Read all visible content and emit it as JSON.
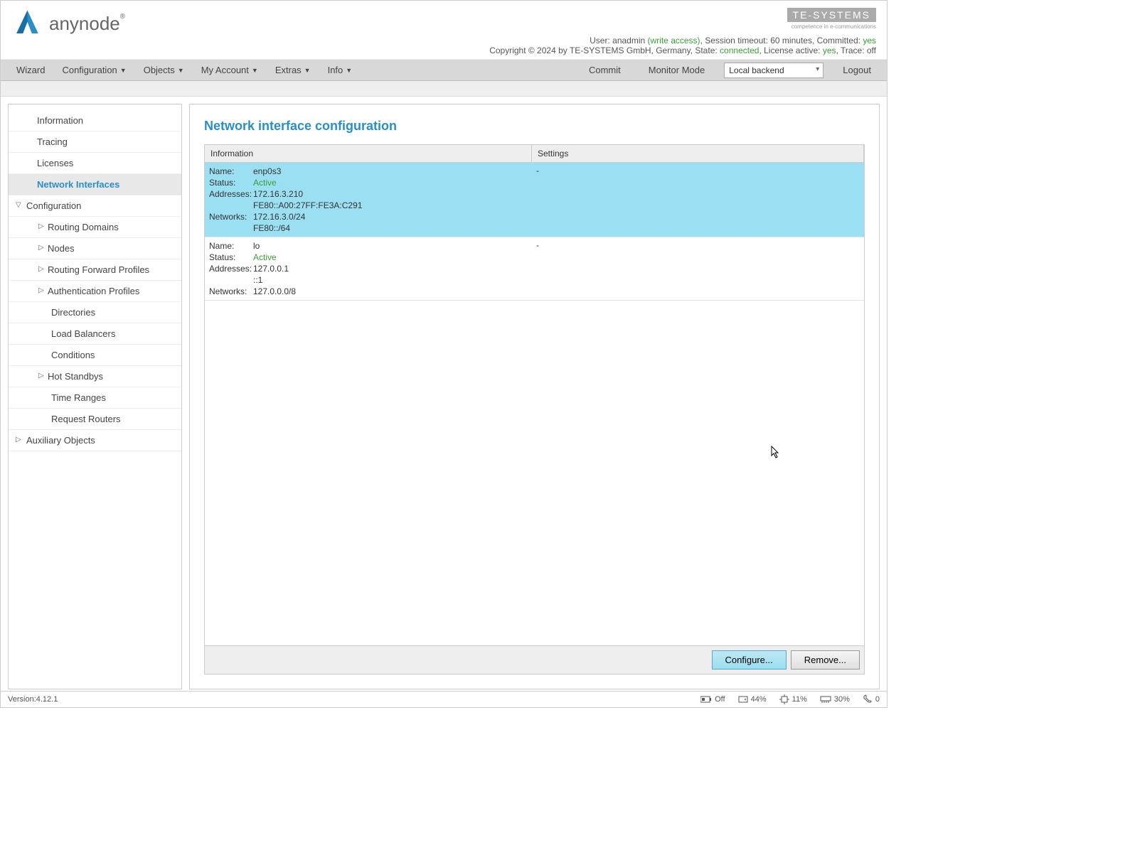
{
  "header": {
    "logo_text": "anynode",
    "company": "TE-SYSTEMS",
    "tagline": "competence in e-communications",
    "user_line_prefix": "User: ",
    "user": "anadmin",
    "access": " (write access)",
    "session_prefix": ", Session timeout: ",
    "session_timeout": "60 minutes",
    "committed_prefix": ", Committed: ",
    "committed": "yes",
    "copyright": "Copyright © 2024 by TE-SYSTEMS GmbH, Germany, State: ",
    "state": "connected",
    "license_prefix": ", License active: ",
    "license": "yes",
    "trace_prefix": ", Trace: ",
    "trace": "off"
  },
  "menu": {
    "wizard": "Wizard",
    "configuration": "Configuration",
    "objects": "Objects",
    "my_account": "My Account",
    "extras": "Extras",
    "info": "Info",
    "commit": "Commit",
    "monitor": "Monitor Mode",
    "backend": "Local backend",
    "logout": "Logout"
  },
  "sidebar": {
    "information": "Information",
    "tracing": "Tracing",
    "licenses": "Licenses",
    "network_interfaces": "Network Interfaces",
    "configuration": "Configuration",
    "routing_domains": "Routing Domains",
    "nodes": "Nodes",
    "routing_forward": "Routing Forward Profiles",
    "auth_profiles": "Authentication Profiles",
    "directories": "Directories",
    "load_balancers": "Load Balancers",
    "conditions": "Conditions",
    "hot_standbys": "Hot Standbys",
    "time_ranges": "Time Ranges",
    "request_routers": "Request Routers",
    "auxiliary": "Auxiliary Objects"
  },
  "main": {
    "title": "Network interface configuration",
    "th_info": "Information",
    "th_settings": "Settings",
    "labels": {
      "name": "Name:",
      "status": "Status:",
      "addresses": "Addresses:",
      "networks": "Networks:"
    },
    "rows": [
      {
        "name": "enp0s3",
        "status": "Active",
        "addr1": "172.16.3.210",
        "addr2": "FE80::A00:27FF:FE3A:C291",
        "net1": "172.16.3.0/24",
        "net2": "FE80::/64",
        "settings": "-",
        "selected": true
      },
      {
        "name": "lo",
        "status": "Active",
        "addr1": "127.0.0.1",
        "addr2": "::1",
        "net1": "127.0.0.0/8",
        "net2": "",
        "settings": "-",
        "selected": false
      }
    ],
    "configure_btn": "Configure...",
    "remove_btn": "Remove..."
  },
  "footer": {
    "version_label": "Version: ",
    "version": "4.12.1",
    "off": "Off",
    "disk": "44%",
    "cpu": "11%",
    "mem": "30%",
    "calls": "0"
  }
}
